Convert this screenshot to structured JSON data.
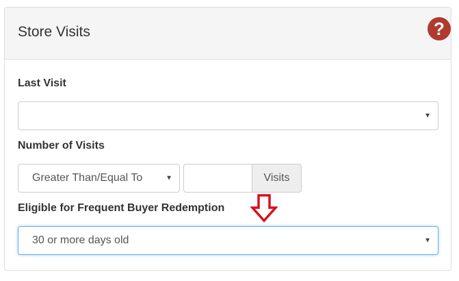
{
  "panel": {
    "title": "Store Visits",
    "help_icon": "question-circle-icon",
    "help_glyph": "?"
  },
  "last_visit": {
    "label": "Last Visit",
    "value": ""
  },
  "number_of_visits": {
    "label": "Number of Visits",
    "operator": "Greater Than/Equal To",
    "count_value": "",
    "addon": "Visits"
  },
  "frequent_buyer": {
    "label": "Eligible for Frequent Buyer Redemption",
    "value": "30 or more days old"
  },
  "colors": {
    "help_icon": "#b03a2e",
    "arrow": "#d9101e",
    "focus_border": "#66afe9"
  }
}
